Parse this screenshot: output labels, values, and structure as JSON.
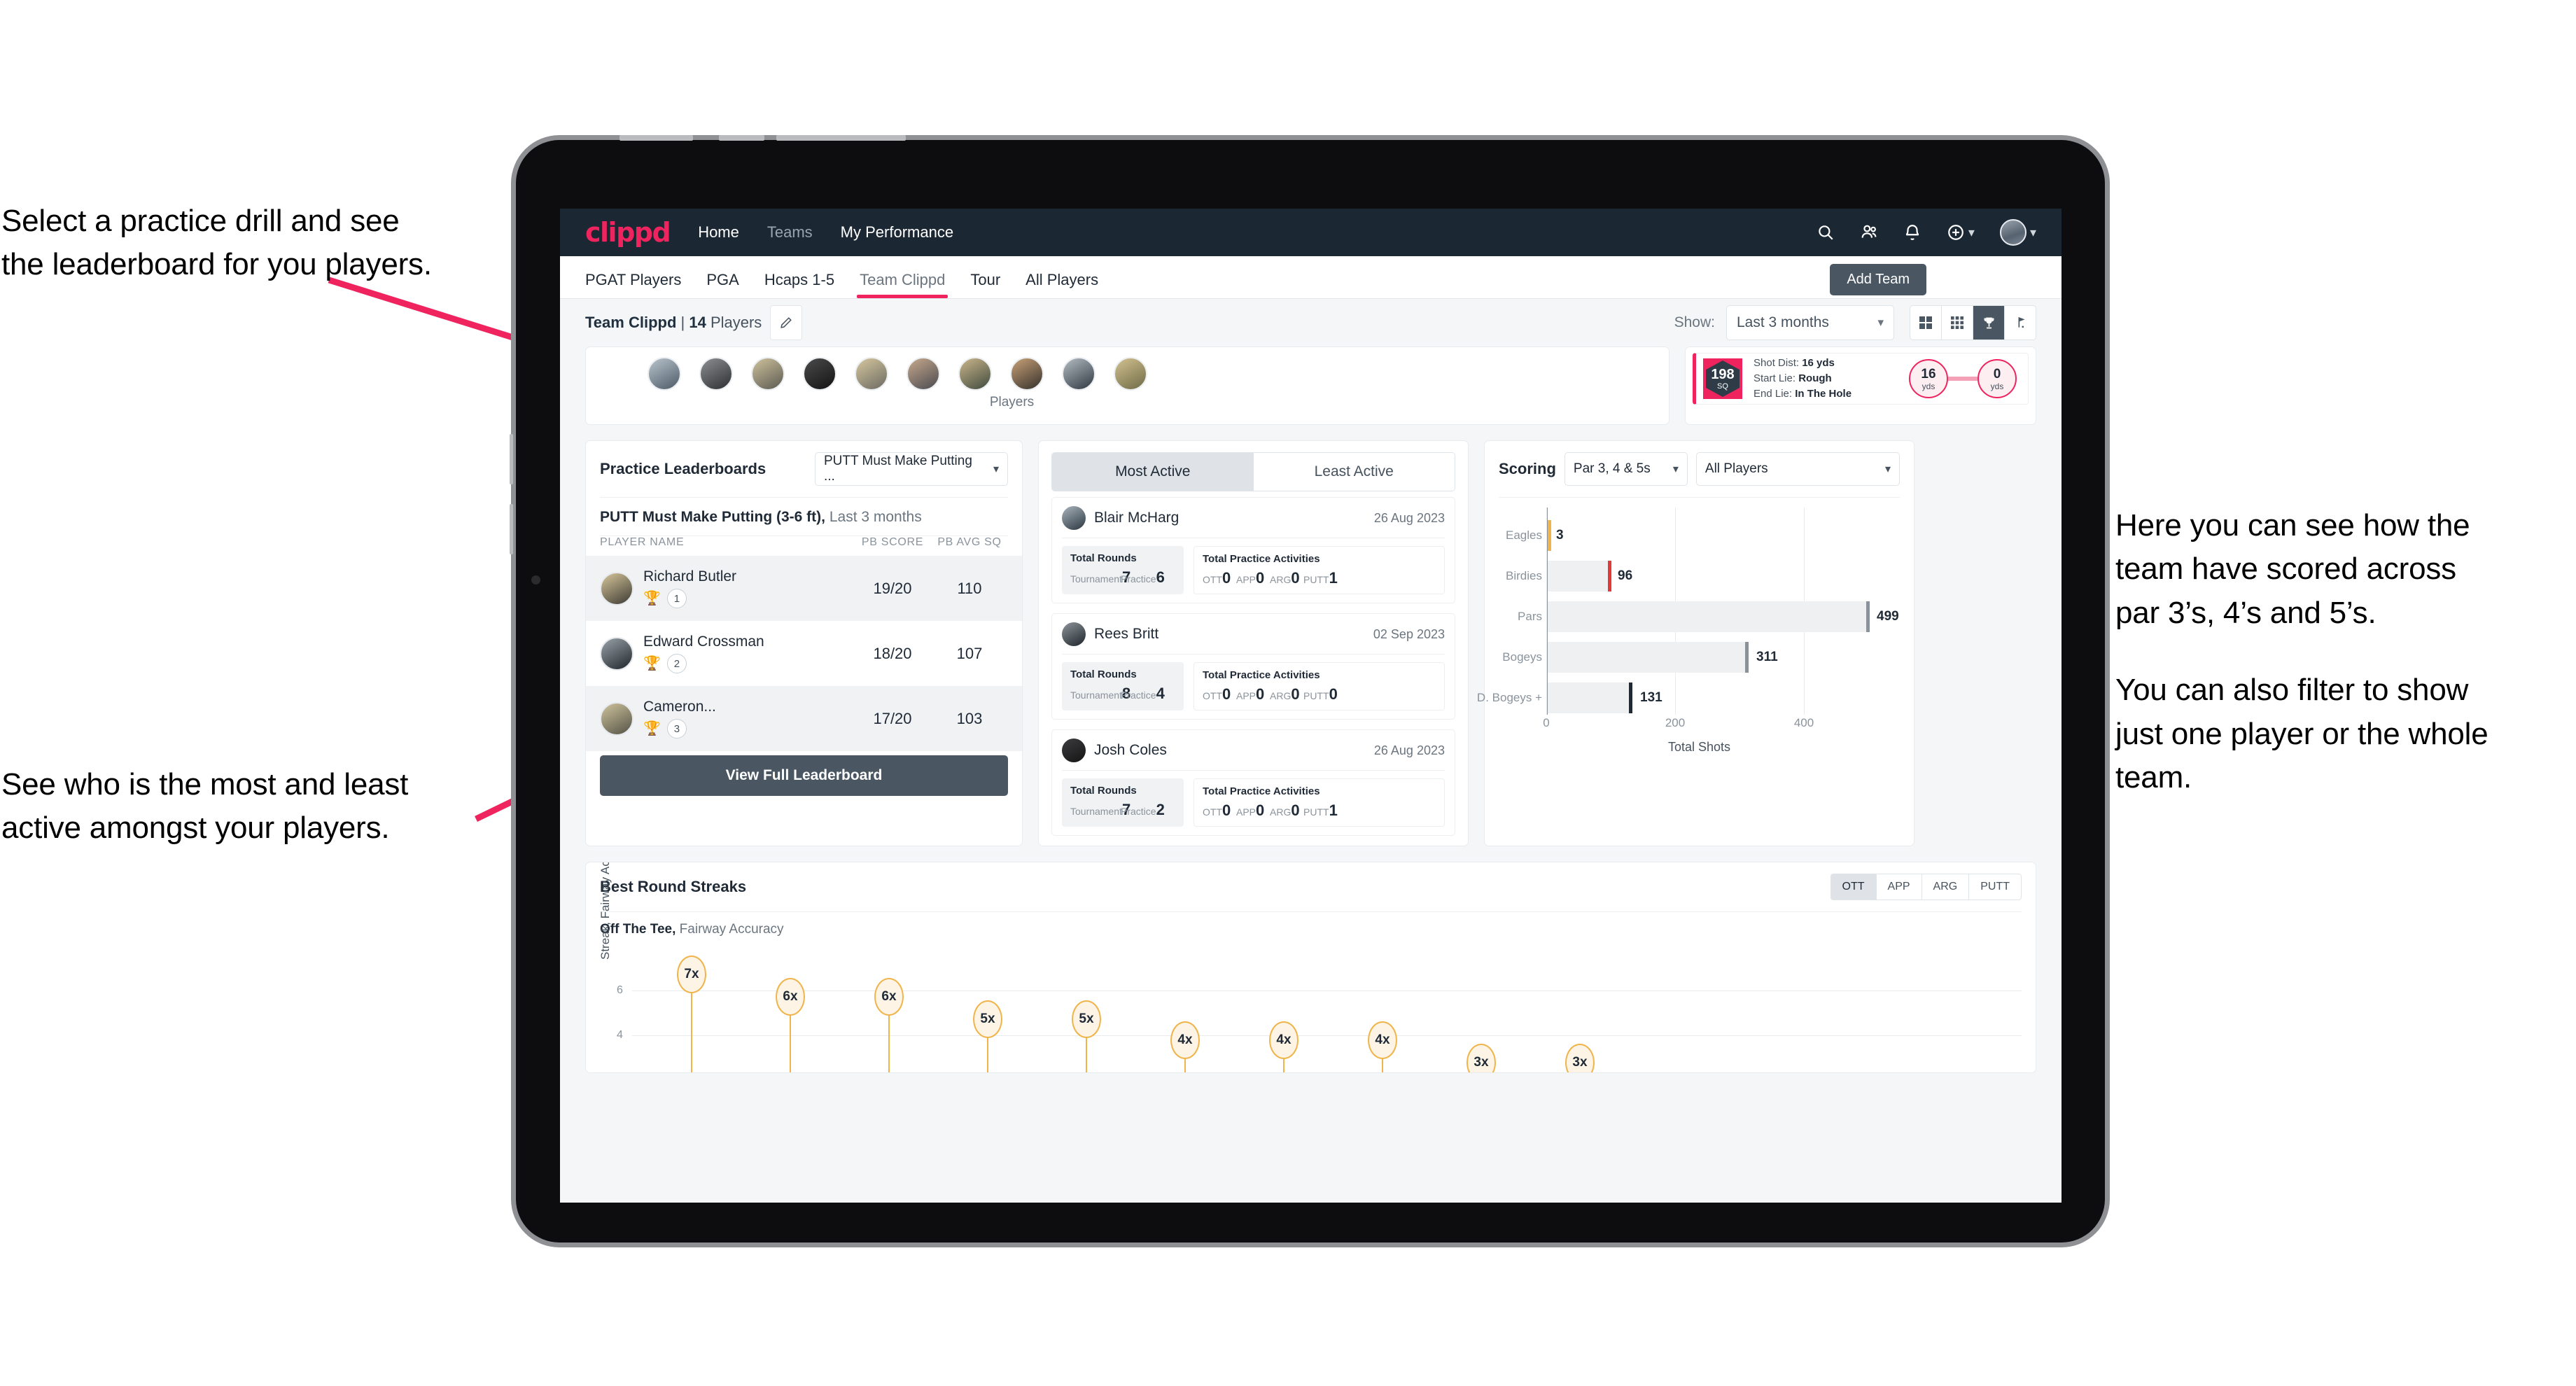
{
  "annotations": {
    "left_top": [
      "Select a practice drill and see",
      "the leaderboard for you players."
    ],
    "left_bottom": [
      "See who is the most and least",
      "active amongst your players."
    ],
    "right": [
      "Here you can see how the",
      "team have scored across",
      "par 3’s, 4’s and 5’s.",
      "You can also filter to show",
      "just one player or the whole",
      "team."
    ]
  },
  "navbar": {
    "logo": "clippd",
    "links": [
      {
        "label": "Home",
        "active": true
      },
      {
        "label": "Teams",
        "active": false
      },
      {
        "label": "My Performance",
        "active": true
      }
    ],
    "icons": [
      "search-icon",
      "people-icon",
      "bell-icon",
      "plus-circle-icon",
      "avatar"
    ]
  },
  "tabs": [
    {
      "label": "PGAT Players",
      "active": false
    },
    {
      "label": "PGA",
      "active": false
    },
    {
      "label": "Hcaps 1-5",
      "active": false
    },
    {
      "label": "Team Clippd",
      "active": true
    },
    {
      "label": "Tour",
      "active": false
    },
    {
      "label": "All Players",
      "active": false
    }
  ],
  "add_team_button": "Add Team",
  "subheader": {
    "team_name": "Team Clippd",
    "separator": " | ",
    "player_count": "14",
    "players_word": " Players",
    "show_label": "Show:",
    "show_value": "Last 3 months",
    "view_modes": [
      "grid-large-icon",
      "grid-small-icon",
      "trophy-icon",
      "flag-icon"
    ],
    "active_view_mode": 2
  },
  "players_strip": {
    "caption": "Players",
    "avatar_count": 10
  },
  "shot_card": {
    "sq_value": "198",
    "sq_unit": "SQ",
    "lines": [
      {
        "label": "Shot Dist: ",
        "value": "16 yds"
      },
      {
        "label": "Start Lie: ",
        "value": "Rough"
      },
      {
        "label": "End Lie: ",
        "value": "In The Hole"
      }
    ],
    "start_yds": "16",
    "end_yds": "0",
    "yds_unit": "yds"
  },
  "practice_leaderboard": {
    "title": "Practice Leaderboards",
    "drill_select": "PUTT Must Make Putting ...",
    "subtitle_bold": "PUTT Must Make Putting (3-6 ft),",
    "subtitle_light": " Last 3 months",
    "columns": [
      "PLAYER NAME",
      "PB SCORE",
      "PB AVG SQ"
    ],
    "rows": [
      {
        "name": "Richard Butler",
        "rank": "1",
        "trophy": "gold",
        "pb_score": "19/20",
        "pb_avg_sq": "110",
        "highlight": true
      },
      {
        "name": "Edward Crossman",
        "rank": "2",
        "trophy": "silver",
        "pb_score": "18/20",
        "pb_avg_sq": "107",
        "highlight": false
      },
      {
        "name": "Cameron...",
        "rank": "3",
        "trophy": "bronze",
        "pb_score": "17/20",
        "pb_avg_sq": "103",
        "highlight": true
      }
    ],
    "view_full_button": "View Full Leaderboard"
  },
  "activity": {
    "tabs": [
      {
        "label": "Most Active",
        "active": true
      },
      {
        "label": "Least Active",
        "active": false
      }
    ],
    "rounds_title": "Total Rounds",
    "practice_title": "Total Practice Activities",
    "rounds_cols": [
      "Tournament",
      "Practice"
    ],
    "practice_cols": [
      "OTT",
      "APP",
      "ARG",
      "PUTT"
    ],
    "items": [
      {
        "name": "Blair McHarg",
        "date": "26 Aug 2023",
        "rounds": [
          "7",
          "6"
        ],
        "practice": [
          "0",
          "0",
          "0",
          "1"
        ]
      },
      {
        "name": "Rees Britt",
        "date": "02 Sep 2023",
        "rounds": [
          "8",
          "4"
        ],
        "practice": [
          "0",
          "0",
          "0",
          "0"
        ]
      },
      {
        "name": "Josh Coles",
        "date": "26 Aug 2023",
        "rounds": [
          "7",
          "2"
        ],
        "practice": [
          "0",
          "0",
          "0",
          "1"
        ]
      }
    ]
  },
  "scoring": {
    "title": "Scoring",
    "par_select": "Par 3, 4 & 5s",
    "player_select": "All Players"
  },
  "streaks": {
    "title": "Best Round Streaks",
    "segments": [
      {
        "label": "OTT",
        "active": true
      },
      {
        "label": "APP",
        "active": false
      },
      {
        "label": "ARG",
        "active": false
      },
      {
        "label": "PUTT",
        "active": false
      }
    ],
    "sub_bold": "Off The Tee,",
    "sub_light": " Fairway Accuracy"
  },
  "colors": {
    "accent": "#ef245f",
    "nav_bg": "#1b2834",
    "dark_slate": "#4a5763",
    "gold": "#efb44a",
    "page_bg": "#f4f6f8"
  },
  "chart_data": [
    {
      "type": "bar",
      "orientation": "horizontal",
      "title": "Scoring",
      "categories": [
        "Eagles",
        "Birdies",
        "Pars",
        "Bogeys",
        "D. Bogeys +"
      ],
      "values": [
        3,
        96,
        499,
        311,
        131
      ],
      "cap_colors": [
        "#efb44a",
        "#e03b3b",
        "#8a939c",
        "#8a939c",
        "#1f2a36"
      ],
      "xlabel": "Total Shots",
      "ylabel": "",
      "xticks": [
        0,
        200,
        400
      ],
      "xlim": [
        0,
        560
      ],
      "grid": true,
      "legend": "none"
    },
    {
      "type": "scatter",
      "title": "Best Round Streaks",
      "subtitle": "Off The Tee, Fairway Accuracy",
      "ylabel": "Streak, Fairway Accuracy",
      "xlabel": "",
      "yticks": [
        4,
        6
      ],
      "ylim": [
        2,
        8
      ],
      "values": [
        7,
        6,
        6,
        5,
        5,
        4,
        4,
        4,
        3,
        3
      ],
      "point_labels": [
        "7x",
        "6x",
        "6x",
        "5x",
        "5x",
        "4x",
        "4x",
        "4x",
        "3x",
        "3x"
      ],
      "grid": true
    }
  ]
}
